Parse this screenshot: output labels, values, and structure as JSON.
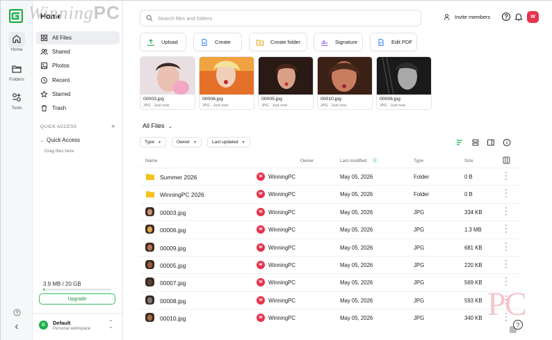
{
  "watermark": {
    "text": "Winning",
    "suffix": "PC",
    "corner": "PC"
  },
  "rail": {
    "items": [
      {
        "label": "Home",
        "icon": "home-icon"
      },
      {
        "label": "Folders",
        "icon": "folder-icon"
      },
      {
        "label": "Tools",
        "icon": "tools-icon"
      }
    ]
  },
  "sidebar": {
    "title": "Home",
    "items": [
      {
        "label": "All Files",
        "icon": "files-icon"
      },
      {
        "label": "Shared",
        "icon": "users-icon"
      },
      {
        "label": "Photos",
        "icon": "image-icon"
      },
      {
        "label": "Recent",
        "icon": "clock-icon"
      },
      {
        "label": "Starred",
        "icon": "star-icon"
      },
      {
        "label": "Trash",
        "icon": "trash-icon"
      }
    ],
    "quick_access_heading": "QUICK ACCESS",
    "quick_access_label": "Quick Access",
    "quick_access_hint": "Drag files here",
    "storage": {
      "text": "3.9 MB / 20 GB",
      "fraction": 0.0002
    },
    "upgrade_label": "Upgrade",
    "workspace": {
      "initial": "D",
      "name": "Default",
      "subtitle": "Personal workspace"
    }
  },
  "header": {
    "search_placeholder": "Search files and folders",
    "invite_label": "Invite members",
    "avatar_initial": "W"
  },
  "quick_actions": [
    {
      "label": "Upload",
      "icon": "upload-icon",
      "color": "#1fae4b"
    },
    {
      "label": "Create",
      "icon": "create-doc-icon",
      "color": "#3b82f6"
    },
    {
      "label": "Create folder",
      "icon": "folder-plus-icon",
      "color": "#e5a50a"
    },
    {
      "label": "Signature",
      "icon": "signature-icon",
      "color": "#8b5cf6"
    },
    {
      "label": "Edit PDF",
      "icon": "edit-pdf-icon",
      "color": "#3b82f6"
    }
  ],
  "recent_cards": [
    {
      "name": "00003.jpg",
      "meta": "JPG · Just now"
    },
    {
      "name": "00006.jpg",
      "meta": "JPG · Just now"
    },
    {
      "name": "00005.jpg",
      "meta": "JPG · Just now"
    },
    {
      "name": "00010.jpg",
      "meta": "JPG · Just now"
    },
    {
      "name": "00008.jpg",
      "meta": "JPG · Just now"
    }
  ],
  "files_view": {
    "title": "All Files",
    "filters": [
      "Type",
      "Owner",
      "Last updated"
    ],
    "columns": {
      "name": "Name",
      "owner": "Owner",
      "modified": "Last modified",
      "type": "Type",
      "size": "Size"
    }
  },
  "rows": [
    {
      "name": "Summer 2026",
      "owner": "WinningPC",
      "owner_initial": "W",
      "modified": "May 05, 2026",
      "type": "Folder",
      "size": "0 B",
      "kind": "folder"
    },
    {
      "name": "WinningPC 2026",
      "owner": "WinningPC",
      "owner_initial": "W",
      "modified": "May 05, 2026",
      "type": "Folder",
      "size": "0 B",
      "kind": "folder"
    },
    {
      "name": "00003.jpg",
      "owner": "WinningPC",
      "owner_initial": "W",
      "modified": "May 05, 2026",
      "type": "JPG",
      "size": "334 KB",
      "kind": "image"
    },
    {
      "name": "00006.jpg",
      "owner": "WinningPC",
      "owner_initial": "W",
      "modified": "May 05, 2026",
      "type": "JPG",
      "size": "1.3 MB",
      "kind": "image"
    },
    {
      "name": "00009.jpg",
      "owner": "WinningPC",
      "owner_initial": "W",
      "modified": "May 05, 2026",
      "type": "JPG",
      "size": "681 KB",
      "kind": "image"
    },
    {
      "name": "00005.jpg",
      "owner": "WinningPC",
      "owner_initial": "W",
      "modified": "May 05, 2026",
      "type": "JPG",
      "size": "220 KB",
      "kind": "image"
    },
    {
      "name": "00007.jpg",
      "owner": "WinningPC",
      "owner_initial": "W",
      "modified": "May 05, 2026",
      "type": "JPG",
      "size": "569 KB",
      "kind": "image"
    },
    {
      "name": "00008.jpg",
      "owner": "WinningPC",
      "owner_initial": "W",
      "modified": "May 05, 2026",
      "type": "JPG",
      "size": "593 KB",
      "kind": "image"
    },
    {
      "name": "00010.jpg",
      "owner": "WinningPC",
      "owner_initial": "W",
      "modified": "May 05, 2026",
      "type": "JPG",
      "size": "340 KB",
      "kind": "image"
    }
  ],
  "colors": {
    "accent": "#1fae4b",
    "owner_badge": "#e8334d",
    "folder": "#f5c21b"
  }
}
